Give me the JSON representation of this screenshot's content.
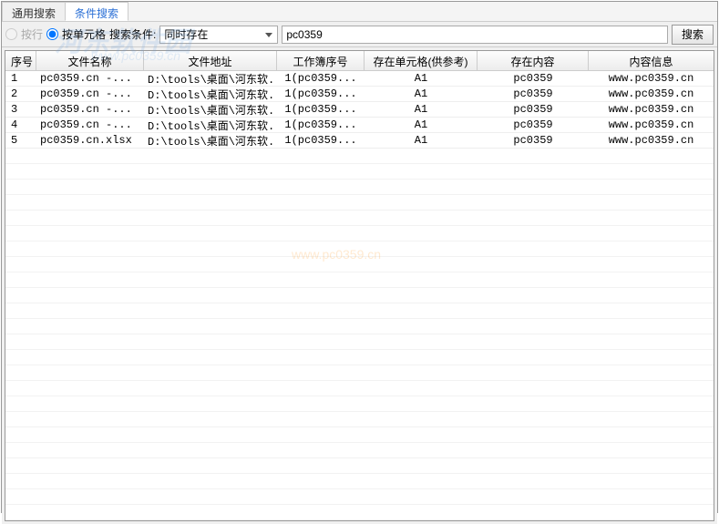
{
  "tabs": {
    "general": "通用搜索",
    "conditional": "条件搜索"
  },
  "toolbar": {
    "by_row": "按行",
    "by_cell": "按单元格",
    "search_condition_label": "搜索条件:",
    "condition_value": "同时存在",
    "search_value": "pc0359",
    "search_btn": "搜索"
  },
  "columns": {
    "c0": "序号",
    "c1": "文件名称",
    "c2": "文件地址",
    "c3": "工作簿序号",
    "c4": "存在单元格(供参考)",
    "c5": "存在内容",
    "c6": "内容信息"
  },
  "rows": [
    {
      "c0": "1",
      "c1": "pc0359.cn -...",
      "c2": "D:\\tools\\桌面\\河东软...",
      "c3": "1(pc0359...",
      "c4": "A1",
      "c5": "pc0359",
      "c6": "www.pc0359.cn"
    },
    {
      "c0": "2",
      "c1": "pc0359.cn -...",
      "c2": "D:\\tools\\桌面\\河东软...",
      "c3": "1(pc0359...",
      "c4": "A1",
      "c5": "pc0359",
      "c6": "www.pc0359.cn"
    },
    {
      "c0": "3",
      "c1": "pc0359.cn -...",
      "c2": "D:\\tools\\桌面\\河东软...",
      "c3": "1(pc0359...",
      "c4": "A1",
      "c5": "pc0359",
      "c6": "www.pc0359.cn"
    },
    {
      "c0": "4",
      "c1": "pc0359.cn -...",
      "c2": "D:\\tools\\桌面\\河东软...",
      "c3": "1(pc0359...",
      "c4": "A1",
      "c5": "pc0359",
      "c6": "www.pc0359.cn"
    },
    {
      "c0": "5",
      "c1": "pc0359.cn.xlsx",
      "c2": "D:\\tools\\桌面\\河东软...",
      "c3": "1(pc0359...",
      "c4": "A1",
      "c5": "pc0359",
      "c6": "www.pc0359.cn"
    }
  ],
  "watermark": {
    "title": "河东软件园",
    "url": "www.pc0359.cn",
    "center": "www.pc0359.cn"
  }
}
